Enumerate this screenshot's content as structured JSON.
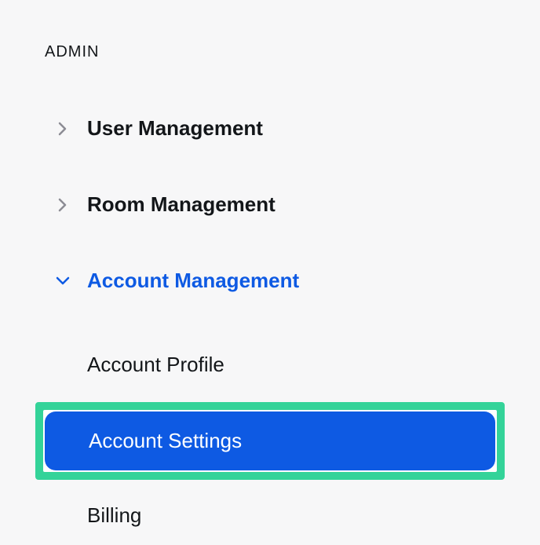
{
  "section": {
    "header": "ADMIN"
  },
  "nav": {
    "items": [
      {
        "label": "User Management",
        "expanded": false
      },
      {
        "label": "Room Management",
        "expanded": false
      },
      {
        "label": "Account Management",
        "expanded": true
      }
    ]
  },
  "subnav": {
    "items": [
      {
        "label": "Account Profile",
        "active": false,
        "highlighted": false
      },
      {
        "label": "Account Settings",
        "active": true,
        "highlighted": true
      },
      {
        "label": "Billing",
        "active": false,
        "highlighted": false
      }
    ]
  },
  "colors": {
    "accent": "#0e5ae3",
    "highlight": "#34d399",
    "text": "#131619",
    "background": "#f7f7f8"
  }
}
